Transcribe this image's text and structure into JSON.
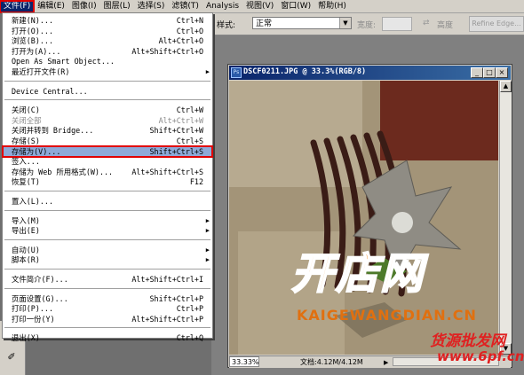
{
  "menubar": {
    "items": [
      {
        "label": "文件(F)",
        "active": true
      },
      {
        "label": "编辑(E)"
      },
      {
        "label": "图像(I)"
      },
      {
        "label": "图层(L)"
      },
      {
        "label": "选择(S)"
      },
      {
        "label": "滤镜(T)"
      },
      {
        "label": "Analysis"
      },
      {
        "label": "视图(V)"
      },
      {
        "label": "窗口(W)"
      },
      {
        "label": "帮助(H)"
      }
    ]
  },
  "options_bar": {
    "style_label": "样式:",
    "style_value": "正常",
    "width_label": "宽度:",
    "height_label": "高度",
    "refine_edge": "Refine Edge..."
  },
  "file_menu": {
    "items": [
      {
        "label": "新建(N)...",
        "shortcut": "Ctrl+N"
      },
      {
        "label": "打开(O)...",
        "shortcut": "Ctrl+O"
      },
      {
        "label": "浏览(B)...",
        "shortcut": "Alt+Ctrl+O"
      },
      {
        "label": "打开为(A)...",
        "shortcut": "Alt+Shift+Ctrl+O"
      },
      {
        "label": "Open As Smart Object...",
        "shortcut": ""
      },
      {
        "label": "最近打开文件(R)",
        "shortcut": "",
        "submenu": true
      },
      {
        "separator": true
      },
      {
        "label": "Device Central...",
        "shortcut": ""
      },
      {
        "separator": true
      },
      {
        "label": "关闭(C)",
        "shortcut": "Ctrl+W"
      },
      {
        "label": "关闭全部",
        "shortcut": "Alt+Ctrl+W",
        "disabled": true
      },
      {
        "label": "关闭并转到 Bridge...",
        "shortcut": "Shift+Ctrl+W"
      },
      {
        "label": "存储(S)",
        "shortcut": "Ctrl+S"
      },
      {
        "label": "存储为(V)...",
        "shortcut": "Shift+Ctrl+S",
        "highlighted": true
      },
      {
        "label": "签入...",
        "shortcut": ""
      },
      {
        "label": "存储为 Web 所用格式(W)...",
        "shortcut": "Alt+Shift+Ctrl+S"
      },
      {
        "label": "恢复(T)",
        "shortcut": "F12"
      },
      {
        "separator": true
      },
      {
        "label": "置入(L)...",
        "shortcut": ""
      },
      {
        "separator": true
      },
      {
        "label": "导入(M)",
        "shortcut": "",
        "submenu": true
      },
      {
        "label": "导出(E)",
        "shortcut": "",
        "submenu": true
      },
      {
        "separator": true
      },
      {
        "label": "自动(U)",
        "shortcut": "",
        "submenu": true
      },
      {
        "label": "脚本(R)",
        "shortcut": "",
        "submenu": true
      },
      {
        "separator": true
      },
      {
        "label": "文件简介(F)...",
        "shortcut": "Alt+Shift+Ctrl+I"
      },
      {
        "separator": true
      },
      {
        "label": "页面设置(G)...",
        "shortcut": "Shift+Ctrl+P"
      },
      {
        "label": "打印(P)...",
        "shortcut": "Ctrl+P"
      },
      {
        "label": "打印一份(Y)",
        "shortcut": "Alt+Shift+Ctrl+P"
      },
      {
        "separator": true
      },
      {
        "label": "退出(X)",
        "shortcut": "Ctrl+Q"
      }
    ]
  },
  "document": {
    "title": "DSCF0211.JPG @ 33.3%(RGB/8)",
    "zoom": "33.33%",
    "doc_size": "文档:4.12M/4.12M"
  },
  "watermarks": {
    "logo": "开店网",
    "url": "KAIGEWANGDIAN.CN",
    "bottom_cn": "货源批发网",
    "bottom_url": "www.6pf.cn"
  },
  "colors": {
    "menu_highlight": "#8eaad8",
    "red_outline": "#e00000",
    "titlebar": "#0a246a",
    "logo_orange": "#f08a1c"
  }
}
